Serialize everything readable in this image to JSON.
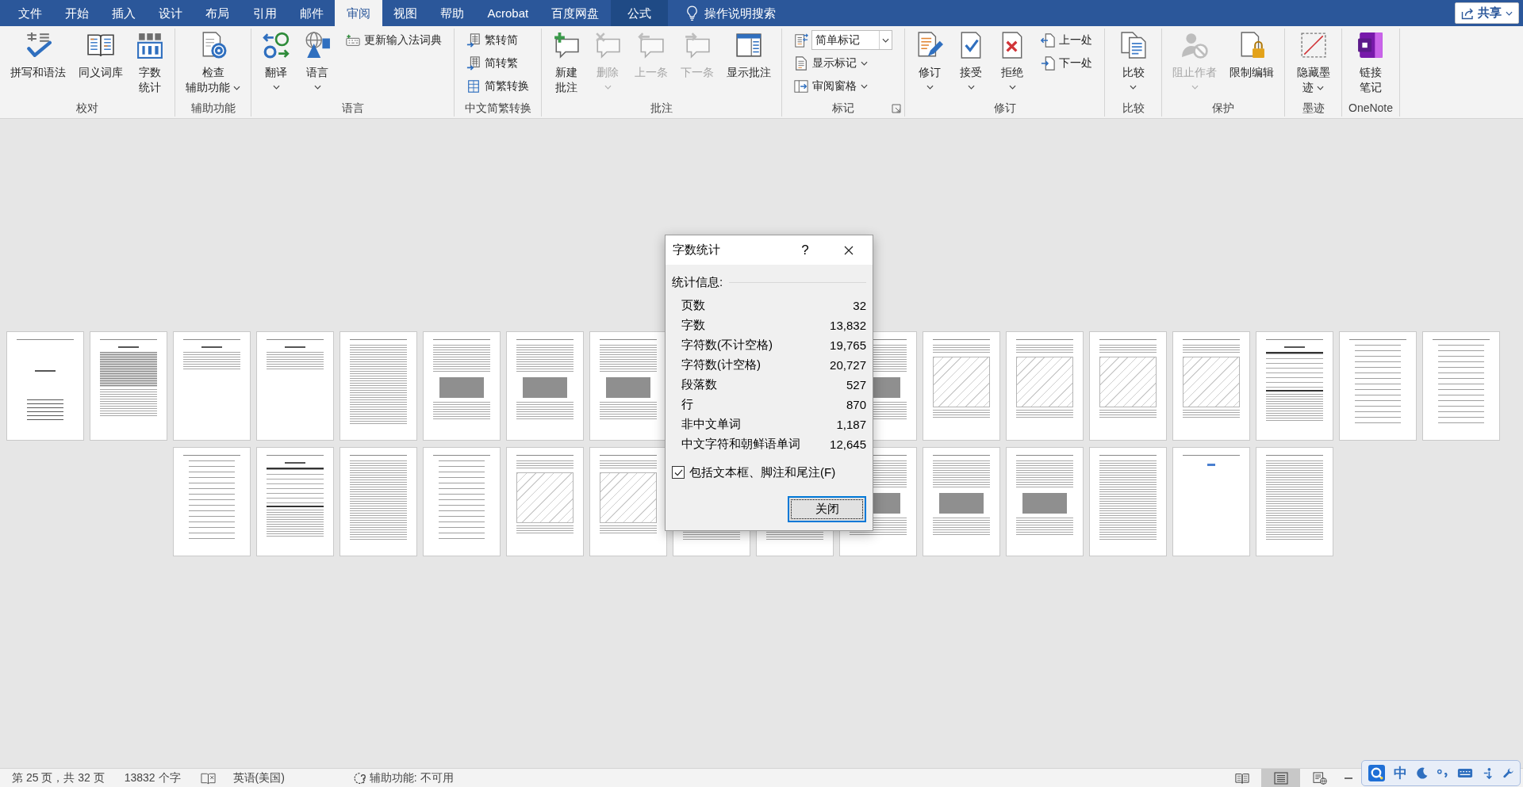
{
  "tabs": [
    {
      "label": "文件",
      "kind": "normal",
      "selected": false
    },
    {
      "label": "开始",
      "kind": "normal",
      "selected": false
    },
    {
      "label": "插入",
      "kind": "normal",
      "selected": false
    },
    {
      "label": "设计",
      "kind": "normal",
      "selected": false
    },
    {
      "label": "布局",
      "kind": "normal",
      "selected": false
    },
    {
      "label": "引用",
      "kind": "normal",
      "selected": false
    },
    {
      "label": "邮件",
      "kind": "normal",
      "selected": false
    },
    {
      "label": "审阅",
      "kind": "normal",
      "selected": true
    },
    {
      "label": "视图",
      "kind": "normal",
      "selected": false
    },
    {
      "label": "帮助",
      "kind": "normal",
      "selected": false
    },
    {
      "label": "Acrobat",
      "kind": "normal",
      "selected": false
    },
    {
      "label": "百度网盘",
      "kind": "normal",
      "selected": false
    },
    {
      "label": "公式",
      "kind": "contextual",
      "selected": false
    }
  ],
  "tell_me": {
    "placeholder": "操作说明搜索"
  },
  "share_button": {
    "label": "共享",
    "dropdown": true
  },
  "ribbon_groups": [
    {
      "label": "校对",
      "items": [
        {
          "kind": "large",
          "lines": [
            "拼写和语法"
          ],
          "dropdown": false,
          "disabled": false
        },
        {
          "kind": "large",
          "lines": [
            "同义词库"
          ],
          "dropdown": false,
          "disabled": false
        },
        {
          "kind": "large",
          "lines": [
            "字数",
            "统计"
          ],
          "dropdown": false,
          "disabled": false
        }
      ]
    },
    {
      "label": "辅助功能",
      "items": [
        {
          "kind": "large",
          "lines": [
            "检查",
            "辅助功能"
          ],
          "dropdown": true,
          "disabled": false
        }
      ]
    },
    {
      "label": "语言",
      "items": [
        {
          "kind": "large",
          "lines": [
            "翻译"
          ],
          "dropdown": true,
          "disabled": false
        },
        {
          "kind": "large",
          "lines": [
            "语言"
          ],
          "dropdown": true,
          "disabled": false
        },
        {
          "kind": "stack",
          "buttons": [
            {
              "kind": "small",
              "label": "更新输入法词典",
              "dropdown": false,
              "disabled": false
            }
          ]
        }
      ]
    },
    {
      "label": "中文简繁转换",
      "items": [
        {
          "kind": "stack",
          "buttons": [
            {
              "kind": "small",
              "label": "繁转简",
              "dropdown": false,
              "disabled": false
            },
            {
              "kind": "small",
              "label": "简转繁",
              "dropdown": false,
              "disabled": false
            },
            {
              "kind": "small",
              "label": "简繁转换",
              "dropdown": false,
              "disabled": false
            }
          ]
        }
      ]
    },
    {
      "label": "批注",
      "items": [
        {
          "kind": "large",
          "lines": [
            "新建",
            "批注"
          ],
          "dropdown": false,
          "disabled": false
        },
        {
          "kind": "large",
          "lines": [
            "删除"
          ],
          "dropdown": true,
          "disabled": true
        },
        {
          "kind": "large",
          "lines": [
            "上一条"
          ],
          "dropdown": false,
          "disabled": true
        },
        {
          "kind": "large",
          "lines": [
            "下一条"
          ],
          "dropdown": false,
          "disabled": true
        },
        {
          "kind": "large",
          "lines": [
            "显示批注"
          ],
          "dropdown": false,
          "disabled": false
        }
      ]
    },
    {
      "label": "标记",
      "launcher": true,
      "items": [
        {
          "kind": "stack",
          "buttons": [
            {
              "kind": "combo",
              "value": "简单标记"
            },
            {
              "kind": "small",
              "label": "显示标记",
              "dropdown": true,
              "disabled": false
            },
            {
              "kind": "small",
              "label": "审阅窗格",
              "dropdown": true,
              "disabled": false
            }
          ]
        }
      ]
    },
    {
      "label": "修订",
      "items": [
        {
          "kind": "large",
          "lines": [
            "修订"
          ],
          "dropdown": true,
          "disabled": false
        },
        {
          "kind": "large",
          "lines": [
            "接受"
          ],
          "dropdown": true,
          "disabled": false
        },
        {
          "kind": "large",
          "lines": [
            "拒绝"
          ],
          "dropdown": true,
          "disabled": false
        },
        {
          "kind": "stack",
          "buttons": [
            {
              "kind": "small",
              "label": "上一处",
              "dropdown": false,
              "disabled": false
            },
            {
              "kind": "small",
              "label": "下一处",
              "dropdown": false,
              "disabled": false
            }
          ]
        }
      ]
    },
    {
      "label": "比较",
      "items": [
        {
          "kind": "large",
          "lines": [
            "比较"
          ],
          "dropdown": true,
          "disabled": false
        }
      ]
    },
    {
      "label": "保护",
      "items": [
        {
          "kind": "large",
          "lines": [
            "阻止作者"
          ],
          "dropdown": true,
          "disabled": true
        },
        {
          "kind": "large",
          "lines": [
            "限制编辑"
          ],
          "dropdown": false,
          "disabled": false
        }
      ]
    },
    {
      "label": "墨迹",
      "items": [
        {
          "kind": "large",
          "lines": [
            "隐藏墨",
            "迹"
          ],
          "dropdown": true,
          "disabled": false
        }
      ]
    },
    {
      "label": "OneNote",
      "items": [
        {
          "kind": "large",
          "lines": [
            "链接",
            "笔记"
          ],
          "dropdown": false,
          "disabled": false
        }
      ]
    }
  ],
  "pages": [
    {
      "kind": "cover"
    },
    {
      "kind": "contents"
    },
    {
      "kind": "text_short"
    },
    {
      "kind": "text_short"
    },
    {
      "kind": "text"
    },
    {
      "kind": "figure"
    },
    {
      "kind": "figure"
    },
    {
      "kind": "figure"
    },
    {
      "kind": "hidden"
    },
    {
      "kind": "hidden"
    },
    {
      "kind": "figure"
    },
    {
      "kind": "drawing"
    },
    {
      "kind": "drawing"
    },
    {
      "kind": "drawing"
    },
    {
      "kind": "drawing"
    },
    {
      "kind": "table"
    },
    {
      "kind": "formula"
    },
    {
      "kind": "formula"
    },
    {
      "kind": "formula"
    },
    {
      "kind": "table"
    },
    {
      "kind": "text"
    },
    {
      "kind": "formula"
    },
    {
      "kind": "drawing"
    },
    {
      "kind": "drawing"
    },
    {
      "kind": "text"
    },
    {
      "kind": "text"
    },
    {
      "kind": "figure"
    },
    {
      "kind": "figure"
    },
    {
      "kind": "figure"
    },
    {
      "kind": "text"
    },
    {
      "kind": "blank"
    },
    {
      "kind": "text"
    }
  ],
  "dialog": {
    "title": "字数统计",
    "help": "?",
    "section": "统计信息:",
    "stats": [
      {
        "label": "页数",
        "value": "32"
      },
      {
        "label": "字数",
        "value": "13,832"
      },
      {
        "label": "字符数(不计空格)",
        "value": "19,765"
      },
      {
        "label": "字符数(计空格)",
        "value": "20,727"
      },
      {
        "label": "段落数",
        "value": "527"
      },
      {
        "label": "行",
        "value": "870"
      },
      {
        "label": "非中文单词",
        "value": "1,187"
      },
      {
        "label": "中文字符和朝鲜语单词",
        "value": "12,645"
      }
    ],
    "checkbox": {
      "label": "包括文本框、脚注和尾注(F)",
      "checked": true
    },
    "button": "关闭"
  },
  "status_bar": {
    "page_info": "第 25 页，共 32 页",
    "word_count": "13832 个字",
    "language": "英语(美国)",
    "accessibility": "辅助功能: 不可用",
    "views": [
      {
        "selected": false
      },
      {
        "selected": true
      },
      {
        "selected": false
      }
    ]
  },
  "ime_toolbar": {
    "mode": "中"
  }
}
